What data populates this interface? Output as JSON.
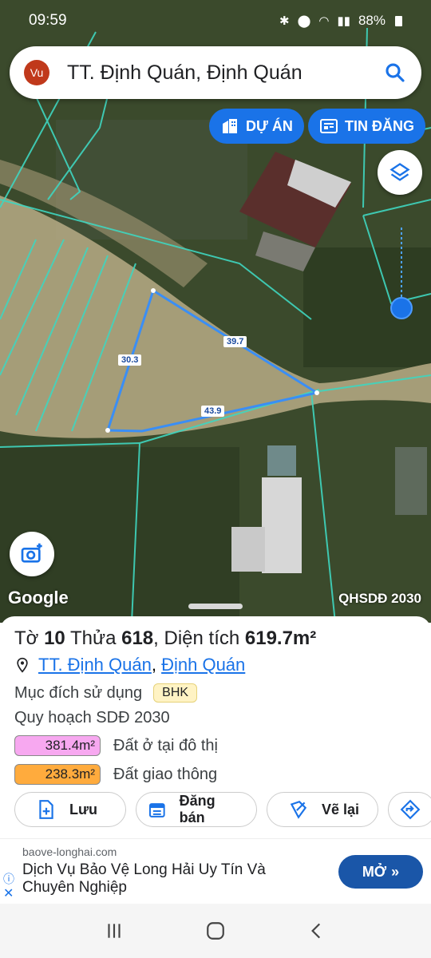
{
  "status_bar": {
    "time": "09:59",
    "battery": "88%"
  },
  "search": {
    "avatar_initials": "Vu",
    "title": "TT. Định Quán, Định Quán"
  },
  "chips": {
    "project": "DỰ ÁN",
    "listings": "TIN ĐĂNG"
  },
  "map": {
    "edge_labels": [
      "30.3",
      "39.7",
      "43.9"
    ],
    "google_logo": "Google",
    "overlay_label": "QHSDĐ 2030",
    "colors": {
      "boundary": "#3fd6c0",
      "parcel": "#3a8ef5",
      "location": "#1a73e8"
    }
  },
  "parcel": {
    "sheet_label": "Tờ",
    "sheet_no": "10",
    "plot_label": "Thửa",
    "plot_no": "618",
    "area_label": ", Diện tích",
    "area_value": "619.7m²",
    "location_town": "TT. Định Quán",
    "location_sep": ",",
    "location_district": "Định Quán",
    "purpose_label": "Mục đích sử dụng",
    "purpose_code": "BHK",
    "planning_label": "Quy hoạch SDĐ 2030",
    "zones": [
      {
        "area": "381.4m²",
        "label": "Đất ở tại đô thị",
        "color": "#f7a8f0"
      },
      {
        "area": "238.3m²",
        "label": "Đất giao thông",
        "color": "#ffab3d"
      }
    ]
  },
  "actions": {
    "save": "Lưu",
    "sell": "Đăng bán",
    "redraw": "Vẽ lại"
  },
  "ad": {
    "domain": "baove-longhai.com",
    "text": "Dịch Vụ Bảo Vệ Long Hải Uy Tín Và Chuyên Nghiệp",
    "button": "MỞ"
  }
}
